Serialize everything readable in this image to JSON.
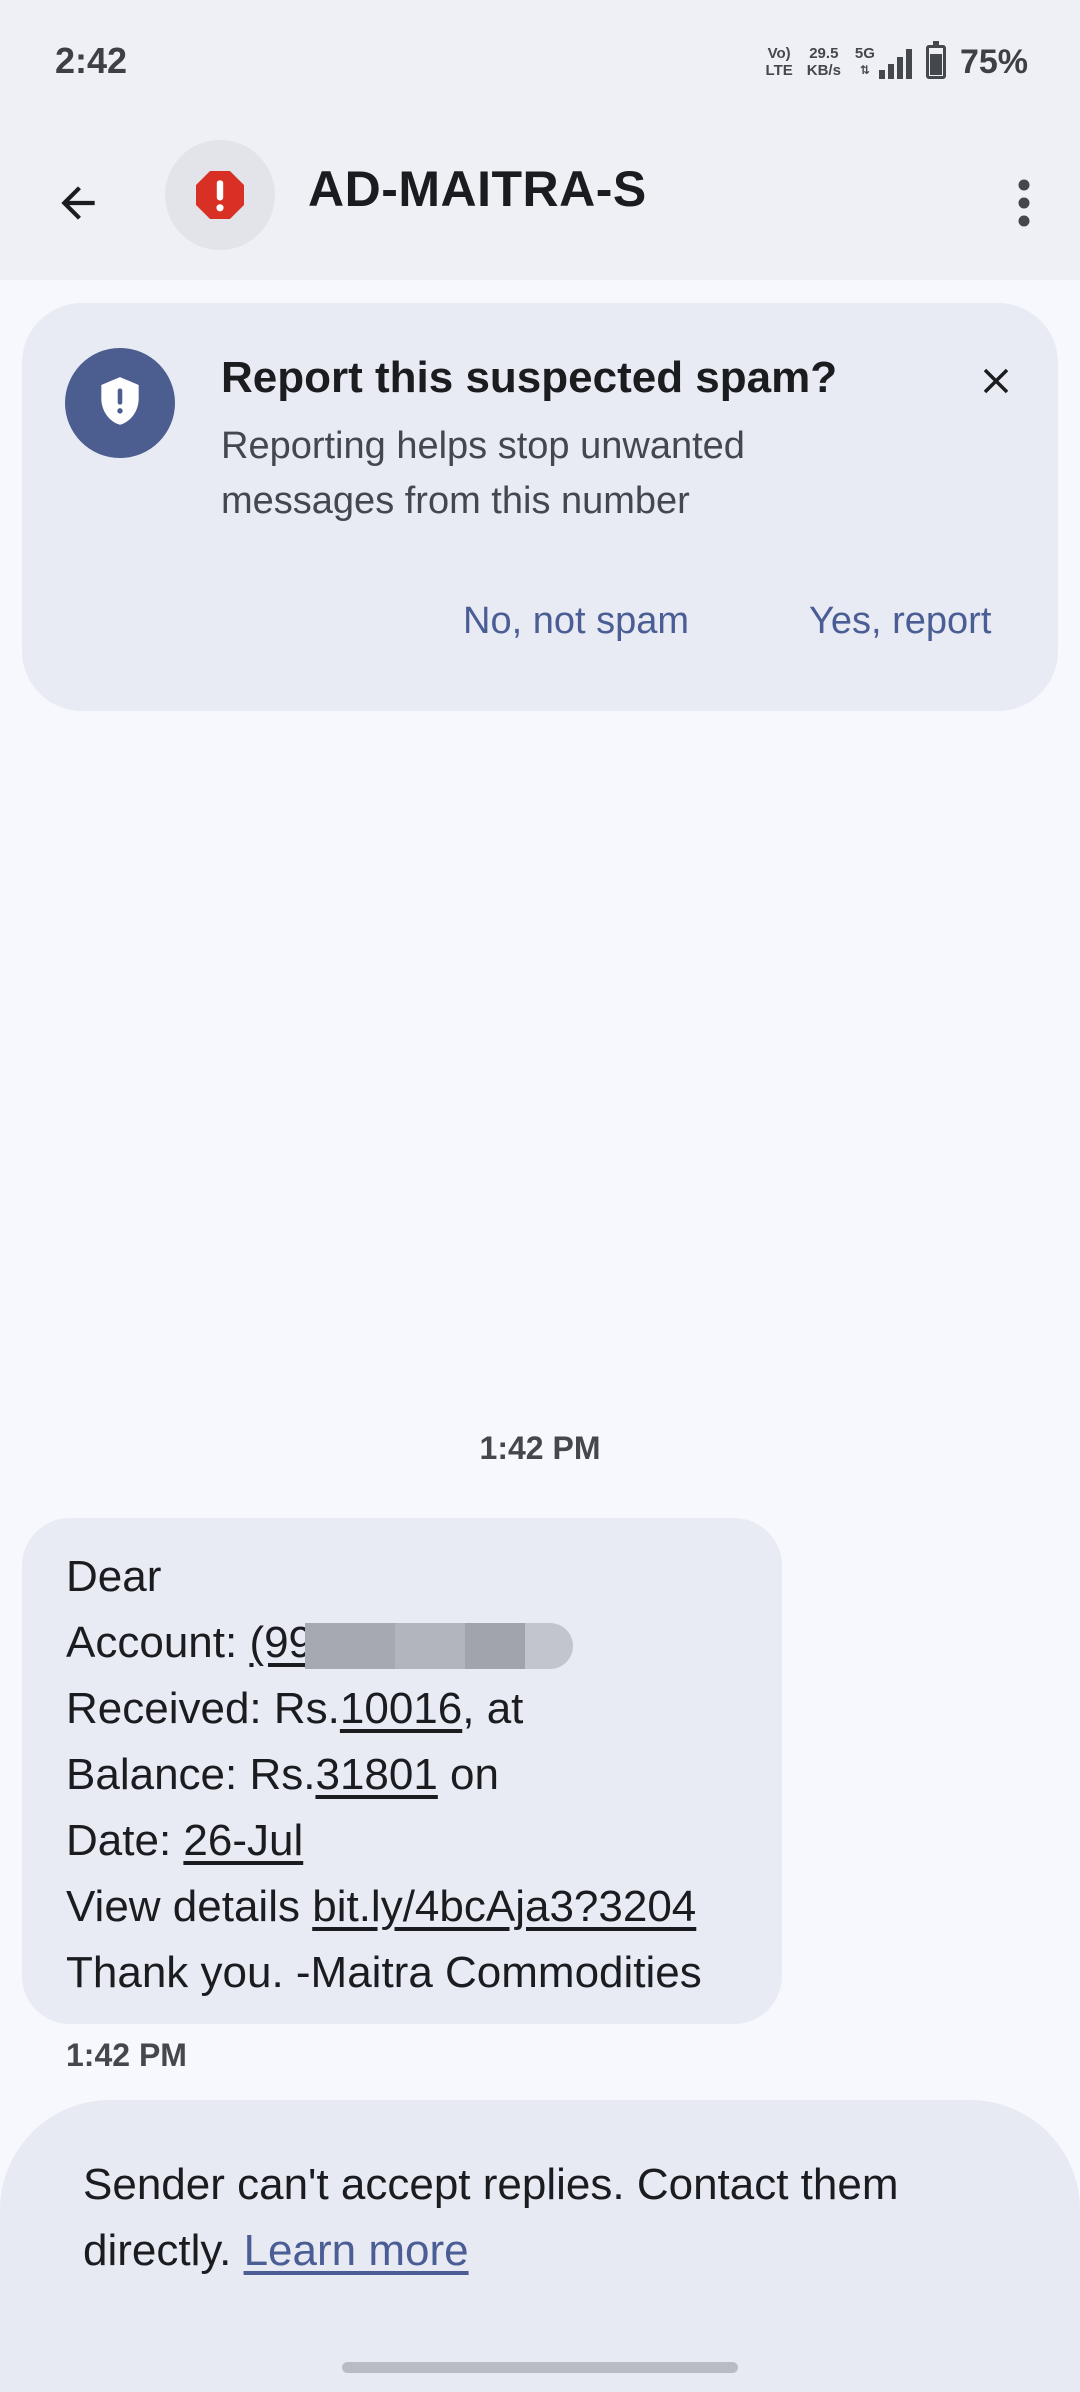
{
  "status_bar": {
    "time": "2:42",
    "volte_top": "Vo)",
    "volte_bottom": "LTE",
    "speed_value": "29.5",
    "speed_unit": "KB/s",
    "network": "5G",
    "battery_percent": "75%",
    "battery_level": 0.75
  },
  "header": {
    "title": "AD-MAITRA-S",
    "icons": {
      "back": "arrow-left-icon",
      "avatar": "spam-alert-icon",
      "more": "more-vertical-icon"
    },
    "alert_color": "#d93025"
  },
  "spam_banner": {
    "title": "Report this suspected spam?",
    "body": "Reporting helps stop unwanted messages from this number",
    "no_label": "No, not spam",
    "yes_label": "Yes, report",
    "accent_color": "#4a5d95"
  },
  "conversation": {
    "timestamp_header": "1:42 PM",
    "message": {
      "line1": "Dear",
      "account_label": "Account: ",
      "account_value": "(99",
      "received_label": "Received: Rs.",
      "received_amount": "10016",
      "received_suffix": ", at",
      "balance_label": "Balance: Rs.",
      "balance_amount": "31801",
      "balance_suffix": " on",
      "date_label": "Date: ",
      "date_value": "26-Jul",
      "view_label": "View details ",
      "link": "bit.ly/4bcAja3?3204",
      "closing": "Thank you. -Maitra Commodities"
    },
    "message_time": "1:42 PM"
  },
  "footer": {
    "notice": "Sender can't accept replies. Contact them directly.",
    "learn_more": "Learn more"
  }
}
